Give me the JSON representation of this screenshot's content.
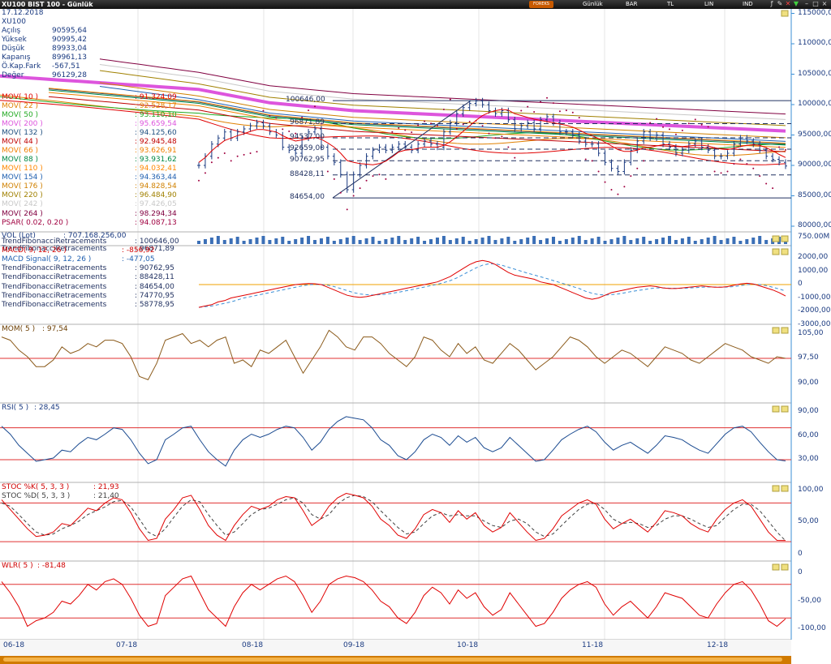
{
  "window": {
    "title": "XU100 BIST 100 - Günlük",
    "brand": "FOREKS",
    "menu": [
      "Günlük",
      "BAR",
      "TL",
      "LIN",
      "IND"
    ]
  },
  "info": {
    "date": "17.12.2018",
    "symbol": "XU100",
    "rows": [
      [
        "Açılış",
        "90595,64"
      ],
      [
        "Yüksek",
        "90995,42"
      ],
      [
        "Düşük",
        "89933,04"
      ],
      [
        "Kapanış",
        "89961,13"
      ],
      [
        "Ö.Kap.Fark",
        "-567,51"
      ],
      [
        "Değer",
        "96129,28"
      ]
    ]
  },
  "indicators": [
    {
      "name": "MOV( 10 )",
      "value": ": 91.324,09",
      "color": "#e00000"
    },
    {
      "name": "MOV( 22 )",
      "value": ": 92.528,17",
      "color": "#e08000"
    },
    {
      "name": "MOV( 50 )",
      "value": ": 93.110,10",
      "color": "#22aa22"
    },
    {
      "name": "MOV( 200 )",
      "value": ": 95.659,54",
      "color": "#dd55dd"
    },
    {
      "name": "MOV( 132 )",
      "value": ": 94.125,60",
      "color": "#205080"
    },
    {
      "name": "MOV( 44 )",
      "value": ": 92.945,48",
      "color": "#c00000"
    },
    {
      "name": "MOV( 66 )",
      "value": ": 93.626,91",
      "color": "#f08000"
    },
    {
      "name": "MOV( 88 )",
      "value": ": 93.931,62",
      "color": "#008844"
    },
    {
      "name": "MOV( 110 )",
      "value": ": 94.032,41",
      "color": "#ff8800"
    },
    {
      "name": "MOV( 154 )",
      "value": ": 94.363,44",
      "color": "#2060b0"
    },
    {
      "name": "MOV( 176 )",
      "value": ": 94.828,54",
      "color": "#d08000"
    },
    {
      "name": "MOV( 220 )",
      "value": ": 96.484,90",
      "color": "#a08000"
    },
    {
      "name": "MOV( 242 )",
      "value": ": 97.426,05",
      "color": "#c8c8c8"
    },
    {
      "name": "MOV( 264 )",
      "value": ": 98.294,34",
      "color": "#800040"
    },
    {
      "name": "PSAR( 0.02, 0.20 )",
      "value": ": 94.087,13",
      "color": "#a00040"
    },
    {
      "name": "TrendFibonacciRetracements",
      "value": ": 100646,00",
      "color": "#203060"
    },
    {
      "name": "TrendFibonacciRetracements",
      "value": ": 96871,89",
      "color": "#203060"
    },
    {
      "name": "TrendFibonacciRetracements",
      "value": ": 90762,95",
      "color": "#203060"
    },
    {
      "name": "TrendFibonacciRetracements",
      "value": ": 88428,11",
      "color": "#203060"
    },
    {
      "name": "TrendFibonacciRetracements",
      "value": ": 84654,00",
      "color": "#203060"
    },
    {
      "name": "TrendFibonacciRetracements",
      "value": ": 74770,95",
      "color": "#203060"
    },
    {
      "name": "TrendFibonacciRetracements",
      "value": ": 58778,95",
      "color": "#203060"
    }
  ],
  "vol_label": "VOL (Lot)",
  "vol_value": ": 707.168.256,00",
  "fib_levels": [
    "100646,00",
    "96871,89",
    "94537,00",
    "92659,00",
    "90762,95",
    "88428,11",
    "84654,00"
  ],
  "macd": {
    "name": "MACD( 9, 12, 26 )",
    "value": ": -856,92",
    "signal_name": "MACD Signal( 9, 12, 26 )",
    "signal_value": ": -477,05"
  },
  "mom": {
    "name": "MOM( 5 )",
    "value": ": 97,54"
  },
  "rsi": {
    "name": "RSI( 5 )",
    "value": ": 28,45"
  },
  "stoc": {
    "k_name": "STOC %K( 5, 3, 3 )",
    "k_value": ": 21,93",
    "d_name": "STOC %D( 5, 3, 3 )",
    "d_value": ": 21,40"
  },
  "wlr": {
    "name": "WLR( 5 )",
    "value": ": -81,48"
  },
  "xaxis": [
    "06-18",
    "07-18",
    "08-18",
    "09-18",
    "10-18",
    "11-18",
    "12-18"
  ],
  "price_axis": [
    "115000,00",
    "110000,00",
    "105000,00",
    "100000,00",
    "95000,00",
    "90000,00",
    "85000,00",
    "80000,00"
  ],
  "vol_axis": [
    "750.00M"
  ],
  "macd_axis": [
    "2000,00",
    "1000,00",
    "0",
    "-1000,00",
    "-2000,00",
    "-3000,00"
  ],
  "mom_axis": [
    "105,00",
    "97,50",
    "90,00"
  ],
  "rsi_axis": [
    "90,00",
    "60,00",
    "30,00"
  ],
  "stoc_axis": [
    "100,00",
    "50,00",
    "0"
  ],
  "wlr_axis": [
    "0",
    "-50,00",
    "-100,00"
  ],
  "chart_data": {
    "type": "line",
    "title": "XU100 BIST 100 - Günlük",
    "x_labels": [
      "06-18",
      "07-18",
      "08-18",
      "09-18",
      "10-18",
      "11-18",
      "12-18"
    ],
    "series": [
      {
        "name": "XU100",
        "values": [
          90000,
          91500,
          93500,
          94500,
          95500,
          94500,
          95500,
          96000,
          96500,
          97000,
          96500,
          95500,
          95000,
          93000,
          92500,
          92000,
          94500,
          95500,
          96000,
          93000,
          91500,
          90500,
          88500,
          86000,
          88500,
          90000,
          91500,
          92500,
          93000,
          92500,
          93000,
          93500,
          93000,
          92500,
          93500,
          94000,
          93500,
          93000,
          95500,
          97000,
          98500,
          99500,
          100200,
          100600,
          100000,
          99000,
          98500,
          99000,
          97500,
          96000,
          96500,
          97000,
          96000,
          97500,
          98000,
          97000,
          95500,
          95500,
          95000,
          94000,
          93500,
          93500,
          92000,
          90500,
          89500,
          89000,
          90500,
          92500,
          94000,
          95500,
          94500,
          95000,
          93500,
          93000,
          92000,
          92500,
          93500,
          94000,
          93000,
          92500,
          91500,
          91500,
          92000,
          93500,
          94500,
          94000,
          93500,
          92500,
          91500,
          91000,
          90500,
          89900
        ]
      },
      {
        "name": "MOV( 10 )",
        "values": [
          90500,
          91300,
          92400,
          93300,
          94100,
          94500,
          94900,
          95200,
          95600,
          95900,
          95900,
          95700,
          95500,
          94900,
          94400,
          94000,
          94200,
          94400,
          94600,
          94300,
          93700,
          93000,
          92000,
          90800,
          90500,
          90300,
          90200,
          90100,
          90300,
          90700,
          91400,
          92200,
          92500,
          92600,
          92800,
          93000,
          93000,
          93000,
          93300,
          93900,
          94700,
          95600,
          96500,
          97400,
          98200,
          98700,
          99000,
          99200,
          99100,
          98500,
          98200,
          97900,
          97600,
          97400,
          97200,
          97000,
          96800,
          96600,
          96300,
          95800,
          95300,
          94900,
          94400,
          93800,
          93200,
          92600,
          92300,
          92300,
          92500,
          92900,
          93000,
          93200,
          93400,
          93400,
          93200,
          93100,
          93200,
          93300,
          93300,
          93200,
          92900,
          92700,
          92600,
          92800,
          93100,
          93300,
          93400,
          93300,
          92900,
          92400,
          91800,
          91300
        ]
      },
      {
        "name": "MOV( 200 )",
        "values": [
          101000,
          100800,
          100600,
          100400,
          100200,
          100000,
          99800,
          99600,
          99400,
          99200,
          99000,
          98800,
          98700,
          98600,
          98500,
          98400,
          98300,
          98200,
          98100,
          98000,
          97900,
          97800,
          97700,
          97600,
          97500,
          97450,
          97400,
          97350,
          97300,
          97250,
          97200,
          97150,
          97100,
          97050,
          97000,
          96950,
          96900,
          96850,
          96800,
          96750,
          96700,
          96650,
          96600,
          96550,
          96500,
          96450,
          96400,
          96350,
          96300,
          96250,
          96200,
          96150,
          96100,
          96050,
          96000,
          95950,
          95900,
          95850,
          95800,
          95750,
          95700,
          95650,
          95600,
          95550,
          95500,
          95450,
          95400,
          95350,
          95300,
          95250,
          95200,
          95150,
          95100,
          95050,
          95000,
          94950,
          94900,
          94850,
          94800,
          94750,
          94700,
          94650,
          94600,
          94550,
          94500,
          94450,
          94400,
          94350,
          94300,
          94250,
          94200,
          94150
        ]
      }
    ],
    "fib_levels": [
      100646,
      96871.89,
      94537,
      92659,
      90762.95,
      88428.11,
      84654
    ],
    "mom": [
      104,
      103,
      100,
      98,
      95,
      95,
      97,
      101,
      99,
      100,
      102,
      101,
      103,
      103,
      102,
      98,
      92,
      91,
      96,
      103,
      104,
      105,
      102,
      103,
      101,
      103,
      104,
      96,
      97,
      95,
      100,
      99,
      101,
      103,
      98,
      93,
      97,
      101,
      106,
      104,
      101,
      100,
      104,
      104,
      102,
      99,
      97,
      95,
      98,
      104,
      103,
      100,
      98,
      102,
      99,
      101,
      97,
      96,
      99,
      102,
      100,
      97,
      94,
      96,
      98,
      101,
      104,
      103,
      101,
      98,
      96,
      98,
      100,
      99,
      97,
      95,
      98,
      101,
      100,
      99,
      97,
      96,
      98,
      100,
      102,
      101,
      100,
      98,
      97,
      96,
      98,
      97.5
    ],
    "rsi": [
      72,
      62,
      48,
      38,
      28,
      30,
      32,
      42,
      40,
      50,
      58,
      55,
      62,
      70,
      68,
      55,
      38,
      25,
      30,
      55,
      62,
      70,
      72,
      55,
      40,
      30,
      22,
      42,
      55,
      62,
      58,
      62,
      68,
      72,
      70,
      58,
      42,
      52,
      68,
      78,
      84,
      82,
      80,
      70,
      55,
      48,
      35,
      30,
      40,
      55,
      62,
      58,
      48,
      60,
      52,
      58,
      45,
      40,
      45,
      58,
      48,
      38,
      28,
      30,
      42,
      55,
      62,
      68,
      72,
      65,
      52,
      42,
      48,
      52,
      45,
      38,
      48,
      60,
      58,
      55,
      48,
      42,
      38,
      50,
      62,
      70,
      72,
      65,
      52,
      40,
      30,
      28.45
    ],
    "stoc_k": [
      85,
      70,
      55,
      40,
      28,
      30,
      35,
      48,
      45,
      58,
      72,
      68,
      80,
      88,
      85,
      65,
      40,
      22,
      25,
      55,
      70,
      88,
      92,
      70,
      45,
      30,
      22,
      45,
      62,
      75,
      70,
      75,
      85,
      90,
      88,
      68,
      45,
      55,
      75,
      88,
      95,
      92,
      88,
      75,
      55,
      45,
      30,
      25,
      40,
      62,
      70,
      65,
      50,
      68,
      55,
      65,
      45,
      35,
      42,
      65,
      50,
      35,
      22,
      25,
      40,
      60,
      70,
      80,
      85,
      78,
      55,
      40,
      48,
      55,
      45,
      35,
      50,
      68,
      65,
      60,
      48,
      40,
      35,
      55,
      70,
      80,
      85,
      75,
      55,
      35,
      22,
      21.93
    ],
    "stoc_d": [
      80,
      75,
      62,
      48,
      35,
      30,
      32,
      40,
      45,
      52,
      62,
      68,
      74,
      82,
      84,
      74,
      55,
      35,
      28,
      40,
      58,
      75,
      85,
      82,
      62,
      45,
      30,
      35,
      48,
      62,
      70,
      72,
      78,
      85,
      88,
      80,
      62,
      55,
      62,
      78,
      88,
      92,
      90,
      82,
      68,
      55,
      42,
      32,
      35,
      48,
      60,
      65,
      60,
      62,
      60,
      60,
      52,
      45,
      42,
      52,
      55,
      48,
      35,
      28,
      32,
      45,
      58,
      70,
      78,
      80,
      70,
      55,
      48,
      50,
      48,
      42,
      45,
      55,
      60,
      60,
      55,
      48,
      42,
      45,
      58,
      70,
      78,
      78,
      68,
      52,
      35,
      21.4
    ],
    "wlr": [
      -15,
      -35,
      -60,
      -95,
      -85,
      -80,
      -70,
      -50,
      -55,
      -40,
      -20,
      -30,
      -15,
      -10,
      -20,
      -45,
      -75,
      -95,
      -90,
      -40,
      -25,
      -10,
      -5,
      -35,
      -65,
      -80,
      -95,
      -60,
      -35,
      -20,
      -30,
      -20,
      -10,
      -5,
      -15,
      -40,
      -70,
      -50,
      -20,
      -10,
      -5,
      -8,
      -15,
      -30,
      -50,
      -60,
      -80,
      -90,
      -70,
      -40,
      -25,
      -35,
      -55,
      -30,
      -45,
      -35,
      -60,
      -75,
      -65,
      -35,
      -55,
      -75,
      -95,
      -90,
      -70,
      -45,
      -30,
      -20,
      -15,
      -25,
      -55,
      -75,
      -60,
      -50,
      -65,
      -80,
      -60,
      -35,
      -40,
      -45,
      -60,
      -75,
      -80,
      -55,
      -35,
      -20,
      -15,
      -30,
      -55,
      -85,
      -95,
      -81.48
    ],
    "macd": [
      -1700,
      -1600,
      -1500,
      -1300,
      -1200,
      -1000,
      -900,
      -800,
      -700,
      -600,
      -500,
      -400,
      -300,
      -200,
      -100,
      0,
      50,
      80,
      60,
      0,
      -200,
      -400,
      -600,
      -800,
      -900,
      -950,
      -900,
      -800,
      -700,
      -600,
      -500,
      -400,
      -300,
      -200,
      -100,
      0,
      100,
      200,
      400,
      600,
      900,
      1200,
      1500,
      1700,
      1800,
      1700,
      1500,
      1200,
      900,
      700,
      600,
      500,
      400,
      200,
      100,
      0,
      -200,
      -400,
      -600,
      -800,
      -1000,
      -1100,
      -1000,
      -800,
      -600,
      -500,
      -400,
      -300,
      -200,
      -150,
      -100,
      -150,
      -250,
      -300,
      -300,
      -250,
      -200,
      -150,
      -100,
      -150,
      -200,
      -200,
      -150,
      -50,
      50,
      100,
      50,
      -100,
      -250,
      -400,
      -600,
      -856.92
    ],
    "macd_signal": [
      -1700,
      -1650,
      -1600,
      -1500,
      -1400,
      -1300,
      -1150,
      -1000,
      -900,
      -800,
      -700,
      -600,
      -500,
      -400,
      -300,
      -200,
      -100,
      -20,
      20,
      0,
      -50,
      -150,
      -300,
      -450,
      -600,
      -700,
      -750,
      -780,
      -760,
      -720,
      -650,
      -570,
      -480,
      -380,
      -280,
      -180,
      -80,
      20,
      150,
      300,
      500,
      750,
      1000,
      1250,
      1450,
      1550,
      1550,
      1450,
      1300,
      1150,
      1000,
      850,
      720,
      580,
      450,
      300,
      150,
      0,
      -150,
      -300,
      -500,
      -650,
      -750,
      -780,
      -750,
      -700,
      -620,
      -530,
      -450,
      -380,
      -300,
      -250,
      -250,
      -270,
      -280,
      -280,
      -260,
      -230,
      -200,
      -180,
      -180,
      -190,
      -190,
      -150,
      -80,
      0,
      30,
      0,
      -80,
      -200,
      -330,
      -477.05
    ]
  }
}
